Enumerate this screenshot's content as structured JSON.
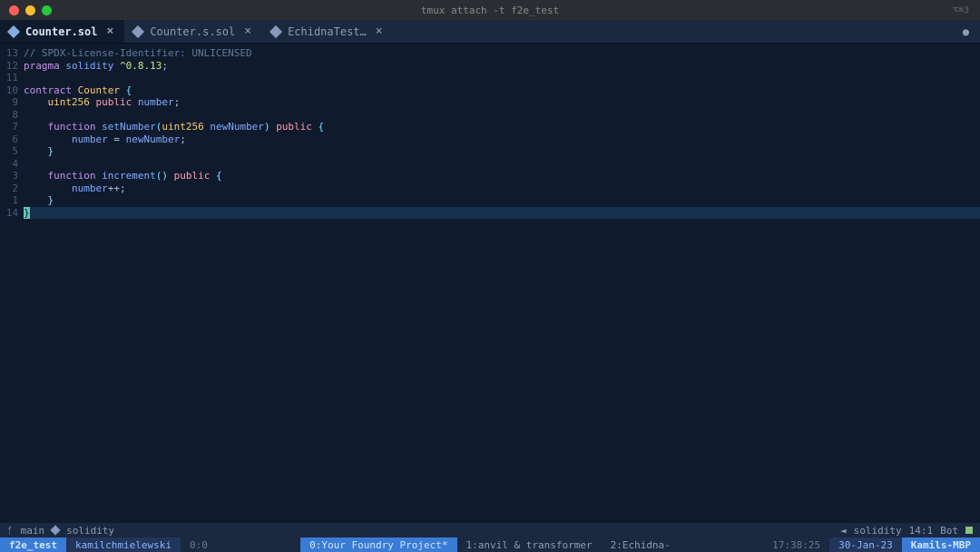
{
  "titlebar": {
    "title": "tmux attach -t f2e_test",
    "shortcut": "⌥⌘3"
  },
  "tabs": [
    {
      "label": "Counter.sol",
      "active": true
    },
    {
      "label": "Counter.s.sol",
      "active": false
    },
    {
      "label": "EchidnaTest…",
      "active": false
    }
  ],
  "code": {
    "gutter": [
      "13",
      "12",
      "11",
      "10",
      "9",
      "8",
      "7",
      "6",
      "5",
      "4",
      "3",
      "2",
      "1",
      "14"
    ],
    "lines": [
      {
        "type": "comment",
        "text": "// SPDX-License-Identifier: UNLICENSED"
      },
      {
        "type": "pragma",
        "kw": "pragma",
        "ident": "solidity",
        "ver": "^0.8.13",
        "semi": ";"
      },
      {
        "type": "blank"
      },
      {
        "type": "contract",
        "kw": "contract",
        "name": "Counter",
        "brace": "{"
      },
      {
        "type": "decl",
        "indent": "    ",
        "dtype": "uint256",
        "vis": "public",
        "name": "number",
        "semi": ";"
      },
      {
        "type": "blank"
      },
      {
        "type": "funcsig",
        "indent": "    ",
        "kw": "function",
        "name": "setNumber",
        "paramtype": "uint256",
        "paramname": "newNumber",
        "vis": "public",
        "brace": "{"
      },
      {
        "type": "assign",
        "indent": "        ",
        "lhs": "number",
        "op": " = ",
        "rhs": "newNumber",
        "semi": ";"
      },
      {
        "type": "close",
        "indent": "    ",
        "brace": "}"
      },
      {
        "type": "blank"
      },
      {
        "type": "funcsig0",
        "indent": "    ",
        "kw": "function",
        "name": "increment",
        "vis": "public",
        "brace": "{"
      },
      {
        "type": "incr",
        "indent": "        ",
        "var": "number",
        "op": "++",
        "semi": ";"
      },
      {
        "type": "close",
        "indent": "    ",
        "brace": "}"
      },
      {
        "type": "cursor",
        "brace": "}"
      }
    ]
  },
  "statusline": {
    "branch": "main",
    "lang_left": "solidity",
    "rec_icon": "◄",
    "lang_right": "solidity",
    "pos": "14:1",
    "scroll": "Bot"
  },
  "tmux": {
    "session": "f2e_test",
    "user": "kamilchmielewski",
    "idx": "0:0",
    "windows": [
      {
        "label": "0:Your Foundry Project*",
        "active": true
      },
      {
        "label": "1:anvil & transformer",
        "active": false
      },
      {
        "label": "2:Echidna-",
        "active": false
      }
    ],
    "time": "17:38:25",
    "date": "30-Jan-23",
    "host": "Kamils-MBP"
  }
}
